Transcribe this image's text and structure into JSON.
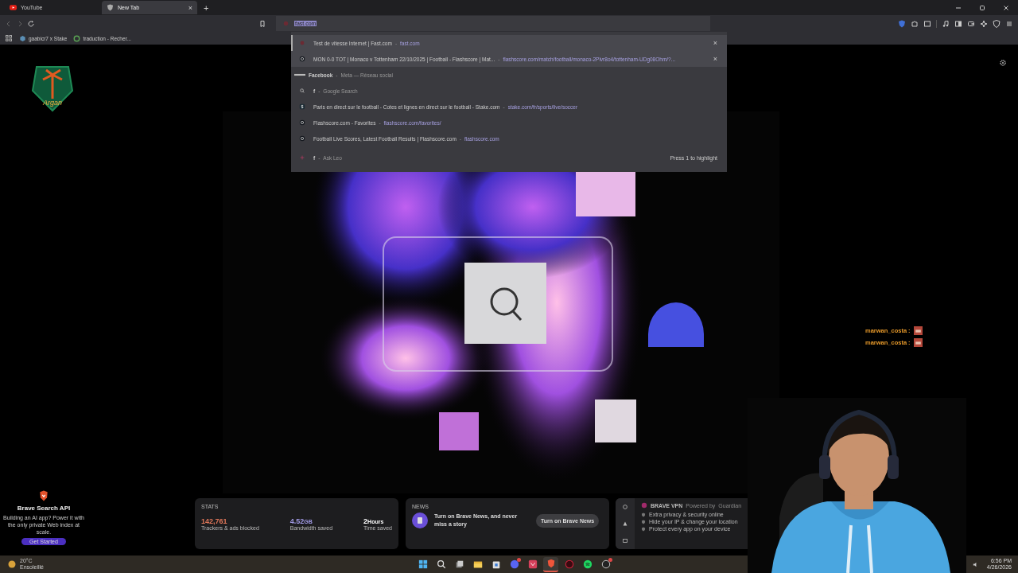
{
  "tabs": [
    {
      "title": "YouTube",
      "kind": "youtube",
      "selected": false
    },
    {
      "title": "New Tab",
      "kind": "brave",
      "selected": true,
      "close": "×"
    }
  ],
  "new_tab": "+",
  "address_bar": {
    "value": "fast.com"
  },
  "bookmarks": [
    {
      "label": "gaabicr7 x Stake",
      "kind": "stake"
    },
    {
      "label": "traduction - Recher...",
      "kind": "google"
    }
  ],
  "suggestions": [
    {
      "kind": "fast",
      "title": "Test de vitesse Internet | Fast.com",
      "sep": "-",
      "url": "fast.com",
      "bold": false,
      "selected": true,
      "hovered": false,
      "remove": "×"
    },
    {
      "kind": "flashscore",
      "title": "MON 0-0 TOT | Monaco v Tottenham 22/10/2025 | Football - Flashscore | Mat...",
      "sep": "-",
      "url": "flashscore.com/match/football/monaco-2Plvr8o4/tottenham-UDg08Ohm/?...",
      "bold": false,
      "selected": false,
      "hovered": true,
      "remove": "×"
    },
    {
      "kind": "facebook",
      "title": "Facebook",
      "sep": "-",
      "description": "Meta — Réseau social",
      "bold": true,
      "selected": false,
      "hovered": false
    },
    {
      "kind": "search",
      "title": "f",
      "sep": "-",
      "description": "Google Search",
      "bold": true,
      "selected": false,
      "hovered": false
    },
    {
      "kind": "stake",
      "title": "Paris en direct sur le football - Cotes et lignes en direct sur le football - Stake.com",
      "sep": "-",
      "url": "stake.com/fr/sports/live/soccer",
      "bold": false,
      "selected": false,
      "hovered": false
    },
    {
      "kind": "flashscore",
      "title": "Flashscore.com - Favorites",
      "sep": "-",
      "url": "flashscore.com/favorites/",
      "bold": false,
      "selected": false,
      "hovered": false
    },
    {
      "kind": "flashscore",
      "title": "Football Live Scores, Latest Football Results | Flashscore.com",
      "sep": "-",
      "url": "flashscore.com",
      "bold": false,
      "selected": false,
      "hovered": false
    },
    {
      "kind": "leo",
      "title": "f",
      "sep": "-",
      "description": "Ask Leo",
      "hint": "Press 1 to highlight",
      "bold": true,
      "selected": false,
      "hovered": false
    }
  ],
  "logo": {
    "text": "Argan"
  },
  "sponsored": {
    "title": "Brave Search API",
    "body": "Building an AI app? Power it with the only private Web index at scale.",
    "button": "Get Started"
  },
  "stats": {
    "title": "STATS",
    "items": [
      {
        "value": "142,761",
        "label": "Trackers & ads blocked",
        "color": "#e0775a"
      },
      {
        "value": "4.52",
        "unit": "GB",
        "label": "Bandwidth saved",
        "color": "#a29be6"
      },
      {
        "value": "2",
        "unit": "Hours",
        "label": "Time saved",
        "color": "#ffffff"
      }
    ]
  },
  "news": {
    "title": "NEWS",
    "text": "Turn on Brave News, and never miss a story",
    "button": "Turn on Brave News"
  },
  "vpn": {
    "title": "BRAVE VPN",
    "powered": "Powered by",
    "partner": "Guardian",
    "features": [
      "Extra privacy & security online",
      "Hide your IP & change your location",
      "Protect every app on your device"
    ]
  },
  "chat": [
    {
      "user": "marwan_costa",
      "sep": ":"
    },
    {
      "user": "marwan_costa",
      "sep": ":"
    }
  ],
  "weather": {
    "temp": "20°C",
    "condition": "Ensoleillé"
  },
  "taskbar": [
    {
      "kind": "windows",
      "active": false,
      "badge": false
    },
    {
      "kind": "search",
      "active": false,
      "badge": false
    },
    {
      "kind": "taskview",
      "active": false,
      "badge": false
    },
    {
      "kind": "files",
      "active": false,
      "badge": false
    },
    {
      "kind": "store",
      "active": false,
      "badge": false
    },
    {
      "kind": "discord",
      "active": false,
      "badge": true
    },
    {
      "kind": "red",
      "active": false,
      "badge": false
    },
    {
      "kind": "brave",
      "active": true,
      "badge": false
    },
    {
      "kind": "ring",
      "active": false,
      "badge": false
    },
    {
      "kind": "spotify",
      "active": false,
      "badge": false
    },
    {
      "kind": "obs",
      "active": false,
      "badge": true
    }
  ],
  "clock": {
    "time": "6:56 PM",
    "date": "4/26/2026"
  }
}
